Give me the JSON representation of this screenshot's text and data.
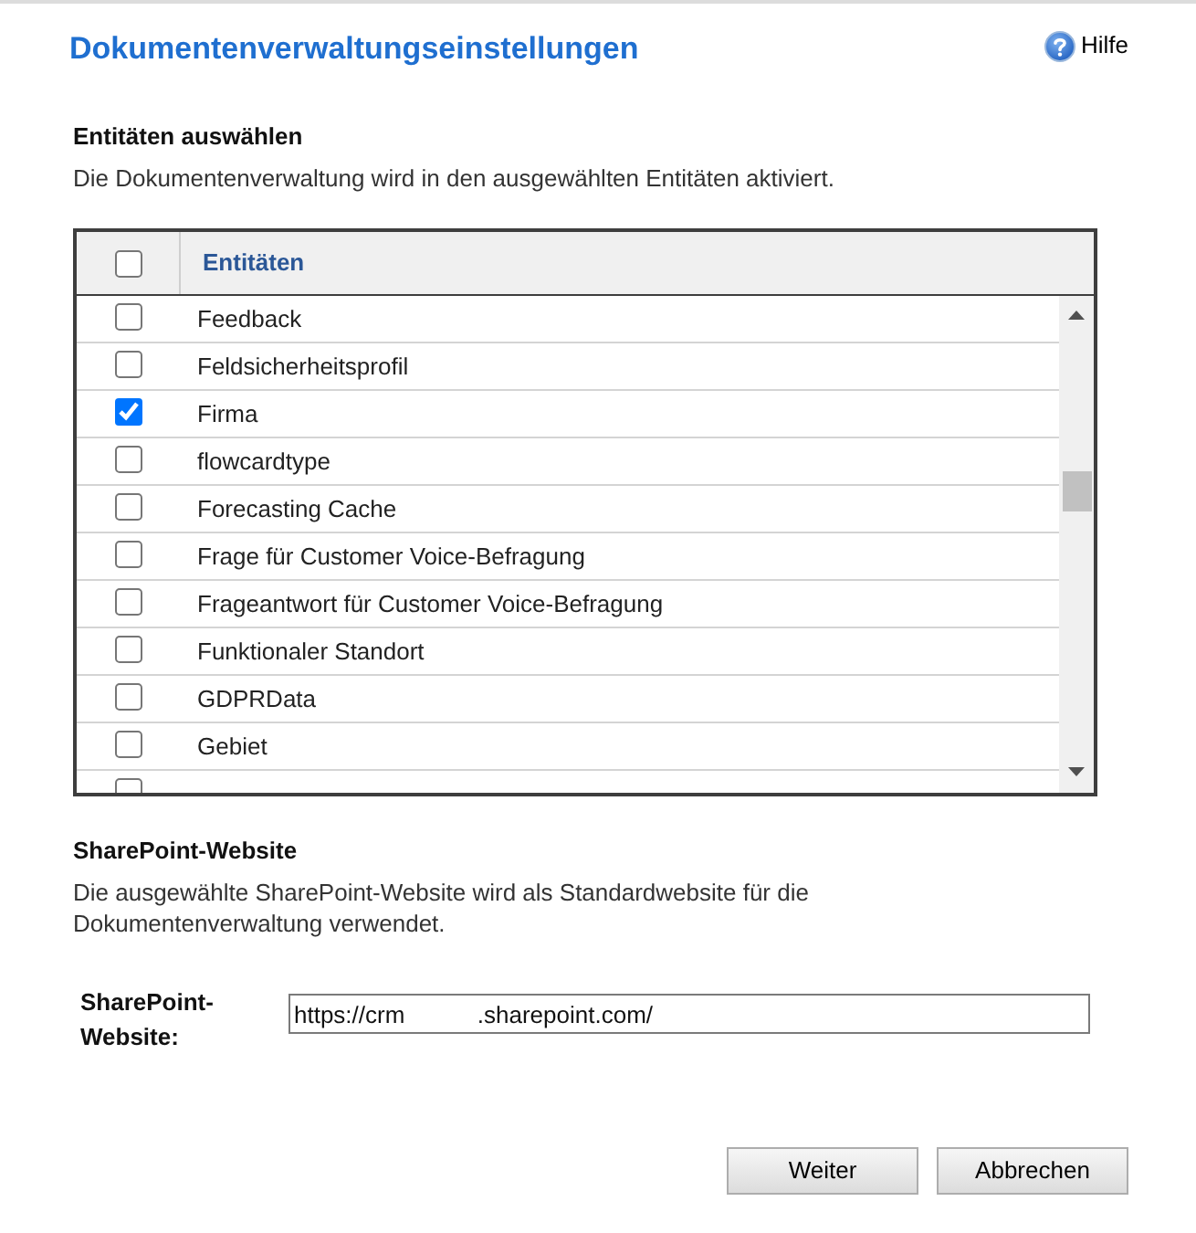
{
  "header": {
    "title": "Dokumentenverwaltungseinstellungen",
    "help_link": {
      "label": "Hilfe"
    }
  },
  "entity_section": {
    "heading": "Entitäten auswählen",
    "description": "Die Dokumentenverwaltung wird in den ausgewählten Entitäten aktiviert."
  },
  "entity_table": {
    "select_all_checked": false,
    "column": "Entitäten",
    "rows": [
      {
        "label": "Feedback",
        "checked": false
      },
      {
        "label": "Feldsicherheitsprofil",
        "checked": false
      },
      {
        "label": "Firma",
        "checked": true
      },
      {
        "label": "flowcardtype",
        "checked": false
      },
      {
        "label": "Forecasting Cache",
        "checked": false
      },
      {
        "label": "Frage für Customer Voice-Befragung",
        "checked": false
      },
      {
        "label": "Frageantwort für Customer Voice-Befragung",
        "checked": false
      },
      {
        "label": "Funktionaler Standort",
        "checked": false
      },
      {
        "label": "GDPRData",
        "checked": false
      },
      {
        "label": "Gebiet",
        "checked": false
      },
      {
        "checked": false
      }
    ]
  },
  "sharepoint_section": {
    "heading": "SharePoint-Website",
    "description": "Die ausgewählte SharePoint-Website wird als Standardwebsite für die Dokumentenverwaltung verwendet.",
    "field_label": "SharePoint-Website:",
    "field_value": "https://crm           .sharepoint.com/"
  },
  "buttons": [
    {
      "label": "Weiter"
    },
    {
      "label": "Abbrechen"
    }
  ]
}
